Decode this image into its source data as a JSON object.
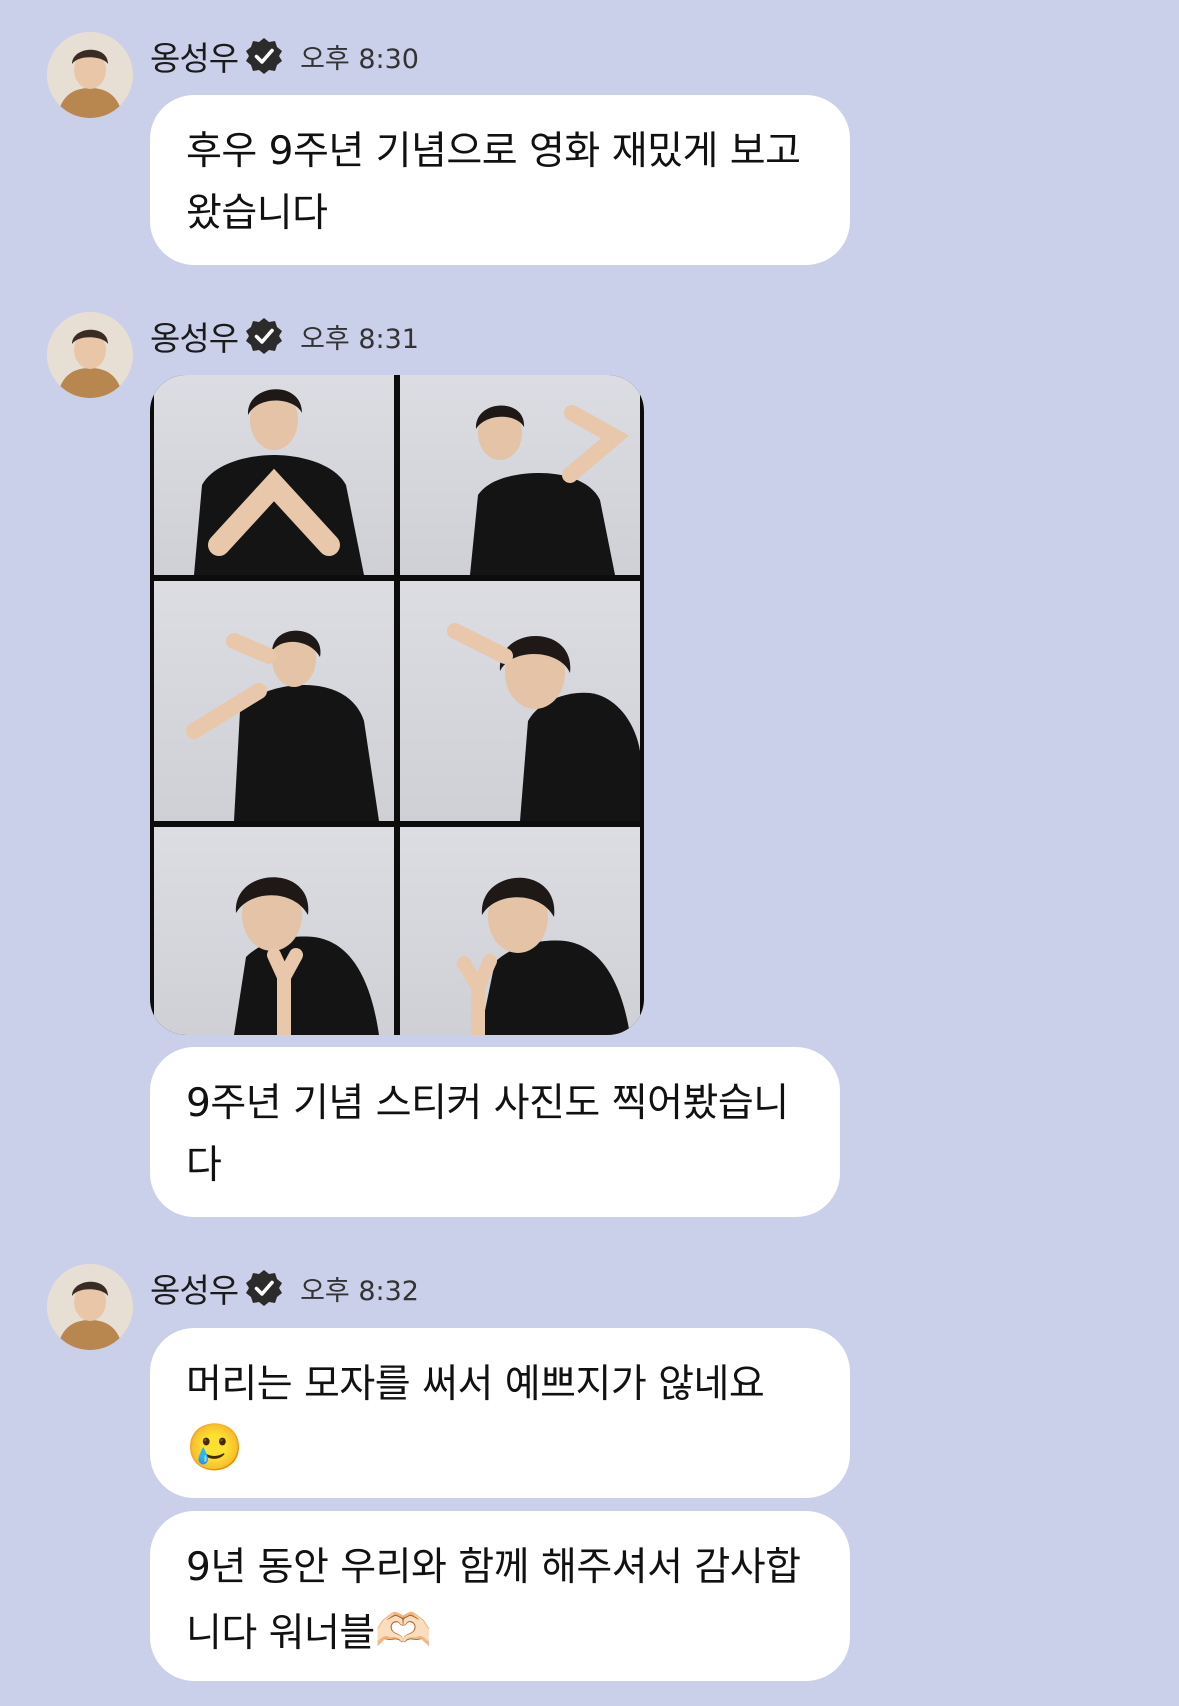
{
  "messages": [
    {
      "sender": "옹성우",
      "time": "오후 8:30",
      "bubbles": [
        "후우 9주년 기념으로 영화 재밌게 보고 왔습니다"
      ]
    },
    {
      "sender": "옹성우",
      "time": "오후 8:31",
      "photo": "sticker-photo-grid",
      "bubbles": [
        "9주년 기념 스티커 사진도 찍어봤습니다"
      ]
    },
    {
      "sender": "옹성우",
      "time": "오후 8:32",
      "bubbles": [
        "머리는 모자를 써서 예쁘지가 않네요",
        "9년 동안 우리와 함께 해주셔서 감사합니다 워너블"
      ],
      "emoji": [
        "🥲",
        "🫶🏻"
      ]
    }
  ],
  "icons": {
    "avatar": "profile-photo",
    "verified": "verified-badge-icon"
  },
  "colors": {
    "background": "#cbd0ea",
    "bubble": "#ffffff",
    "badge": "#2b2b2b"
  }
}
